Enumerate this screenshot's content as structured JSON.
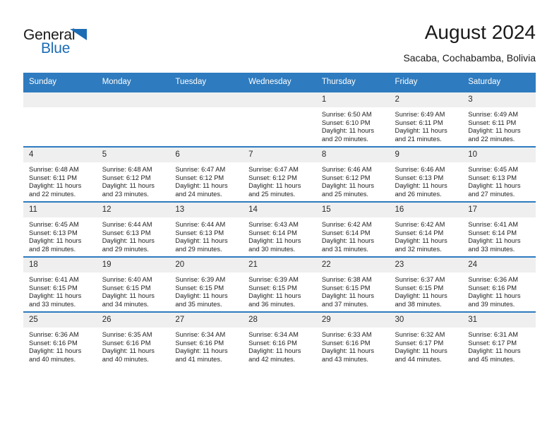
{
  "logo": {
    "word_top": "General",
    "word_bottom": "Blue",
    "triangle_icon": "triangle-icon",
    "color_blue": "#1c6cb4",
    "color_dark": "#1a1a1a"
  },
  "header": {
    "title": "August 2024",
    "subtitle": "Sacaba, Cochabamba, Bolivia"
  },
  "colors": {
    "header_blue": "#2e7bbf",
    "row_border_blue": "#2e7bbf",
    "daynum_band": "#efefef",
    "text": "#1f1f1f"
  },
  "calendar": {
    "weekday_headers": [
      "Sunday",
      "Monday",
      "Tuesday",
      "Wednesday",
      "Thursday",
      "Friday",
      "Saturday"
    ],
    "weeks": [
      [
        {
          "day": "",
          "lines": []
        },
        {
          "day": "",
          "lines": []
        },
        {
          "day": "",
          "lines": []
        },
        {
          "day": "",
          "lines": []
        },
        {
          "day": "1",
          "lines": [
            "Sunrise: 6:50 AM",
            "Sunset: 6:10 PM",
            "Daylight: 11 hours",
            "and 20 minutes."
          ]
        },
        {
          "day": "2",
          "lines": [
            "Sunrise: 6:49 AM",
            "Sunset: 6:11 PM",
            "Daylight: 11 hours",
            "and 21 minutes."
          ]
        },
        {
          "day": "3",
          "lines": [
            "Sunrise: 6:49 AM",
            "Sunset: 6:11 PM",
            "Daylight: 11 hours",
            "and 22 minutes."
          ]
        }
      ],
      [
        {
          "day": "4",
          "lines": [
            "Sunrise: 6:48 AM",
            "Sunset: 6:11 PM",
            "Daylight: 11 hours",
            "and 22 minutes."
          ]
        },
        {
          "day": "5",
          "lines": [
            "Sunrise: 6:48 AM",
            "Sunset: 6:12 PM",
            "Daylight: 11 hours",
            "and 23 minutes."
          ]
        },
        {
          "day": "6",
          "lines": [
            "Sunrise: 6:47 AM",
            "Sunset: 6:12 PM",
            "Daylight: 11 hours",
            "and 24 minutes."
          ]
        },
        {
          "day": "7",
          "lines": [
            "Sunrise: 6:47 AM",
            "Sunset: 6:12 PM",
            "Daylight: 11 hours",
            "and 25 minutes."
          ]
        },
        {
          "day": "8",
          "lines": [
            "Sunrise: 6:46 AM",
            "Sunset: 6:12 PM",
            "Daylight: 11 hours",
            "and 25 minutes."
          ]
        },
        {
          "day": "9",
          "lines": [
            "Sunrise: 6:46 AM",
            "Sunset: 6:13 PM",
            "Daylight: 11 hours",
            "and 26 minutes."
          ]
        },
        {
          "day": "10",
          "lines": [
            "Sunrise: 6:45 AM",
            "Sunset: 6:13 PM",
            "Daylight: 11 hours",
            "and 27 minutes."
          ]
        }
      ],
      [
        {
          "day": "11",
          "lines": [
            "Sunrise: 6:45 AM",
            "Sunset: 6:13 PM",
            "Daylight: 11 hours",
            "and 28 minutes."
          ]
        },
        {
          "day": "12",
          "lines": [
            "Sunrise: 6:44 AM",
            "Sunset: 6:13 PM",
            "Daylight: 11 hours",
            "and 29 minutes."
          ]
        },
        {
          "day": "13",
          "lines": [
            "Sunrise: 6:44 AM",
            "Sunset: 6:13 PM",
            "Daylight: 11 hours",
            "and 29 minutes."
          ]
        },
        {
          "day": "14",
          "lines": [
            "Sunrise: 6:43 AM",
            "Sunset: 6:14 PM",
            "Daylight: 11 hours",
            "and 30 minutes."
          ]
        },
        {
          "day": "15",
          "lines": [
            "Sunrise: 6:42 AM",
            "Sunset: 6:14 PM",
            "Daylight: 11 hours",
            "and 31 minutes."
          ]
        },
        {
          "day": "16",
          "lines": [
            "Sunrise: 6:42 AM",
            "Sunset: 6:14 PM",
            "Daylight: 11 hours",
            "and 32 minutes."
          ]
        },
        {
          "day": "17",
          "lines": [
            "Sunrise: 6:41 AM",
            "Sunset: 6:14 PM",
            "Daylight: 11 hours",
            "and 33 minutes."
          ]
        }
      ],
      [
        {
          "day": "18",
          "lines": [
            "Sunrise: 6:41 AM",
            "Sunset: 6:15 PM",
            "Daylight: 11 hours",
            "and 33 minutes."
          ]
        },
        {
          "day": "19",
          "lines": [
            "Sunrise: 6:40 AM",
            "Sunset: 6:15 PM",
            "Daylight: 11 hours",
            "and 34 minutes."
          ]
        },
        {
          "day": "20",
          "lines": [
            "Sunrise: 6:39 AM",
            "Sunset: 6:15 PM",
            "Daylight: 11 hours",
            "and 35 minutes."
          ]
        },
        {
          "day": "21",
          "lines": [
            "Sunrise: 6:39 AM",
            "Sunset: 6:15 PM",
            "Daylight: 11 hours",
            "and 36 minutes."
          ]
        },
        {
          "day": "22",
          "lines": [
            "Sunrise: 6:38 AM",
            "Sunset: 6:15 PM",
            "Daylight: 11 hours",
            "and 37 minutes."
          ]
        },
        {
          "day": "23",
          "lines": [
            "Sunrise: 6:37 AM",
            "Sunset: 6:15 PM",
            "Daylight: 11 hours",
            "and 38 minutes."
          ]
        },
        {
          "day": "24",
          "lines": [
            "Sunrise: 6:36 AM",
            "Sunset: 6:16 PM",
            "Daylight: 11 hours",
            "and 39 minutes."
          ]
        }
      ],
      [
        {
          "day": "25",
          "lines": [
            "Sunrise: 6:36 AM",
            "Sunset: 6:16 PM",
            "Daylight: 11 hours",
            "and 40 minutes."
          ]
        },
        {
          "day": "26",
          "lines": [
            "Sunrise: 6:35 AM",
            "Sunset: 6:16 PM",
            "Daylight: 11 hours",
            "and 40 minutes."
          ]
        },
        {
          "day": "27",
          "lines": [
            "Sunrise: 6:34 AM",
            "Sunset: 6:16 PM",
            "Daylight: 11 hours",
            "and 41 minutes."
          ]
        },
        {
          "day": "28",
          "lines": [
            "Sunrise: 6:34 AM",
            "Sunset: 6:16 PM",
            "Daylight: 11 hours",
            "and 42 minutes."
          ]
        },
        {
          "day": "29",
          "lines": [
            "Sunrise: 6:33 AM",
            "Sunset: 6:16 PM",
            "Daylight: 11 hours",
            "and 43 minutes."
          ]
        },
        {
          "day": "30",
          "lines": [
            "Sunrise: 6:32 AM",
            "Sunset: 6:17 PM",
            "Daylight: 11 hours",
            "and 44 minutes."
          ]
        },
        {
          "day": "31",
          "lines": [
            "Sunrise: 6:31 AM",
            "Sunset: 6:17 PM",
            "Daylight: 11 hours",
            "and 45 minutes."
          ]
        }
      ]
    ]
  }
}
